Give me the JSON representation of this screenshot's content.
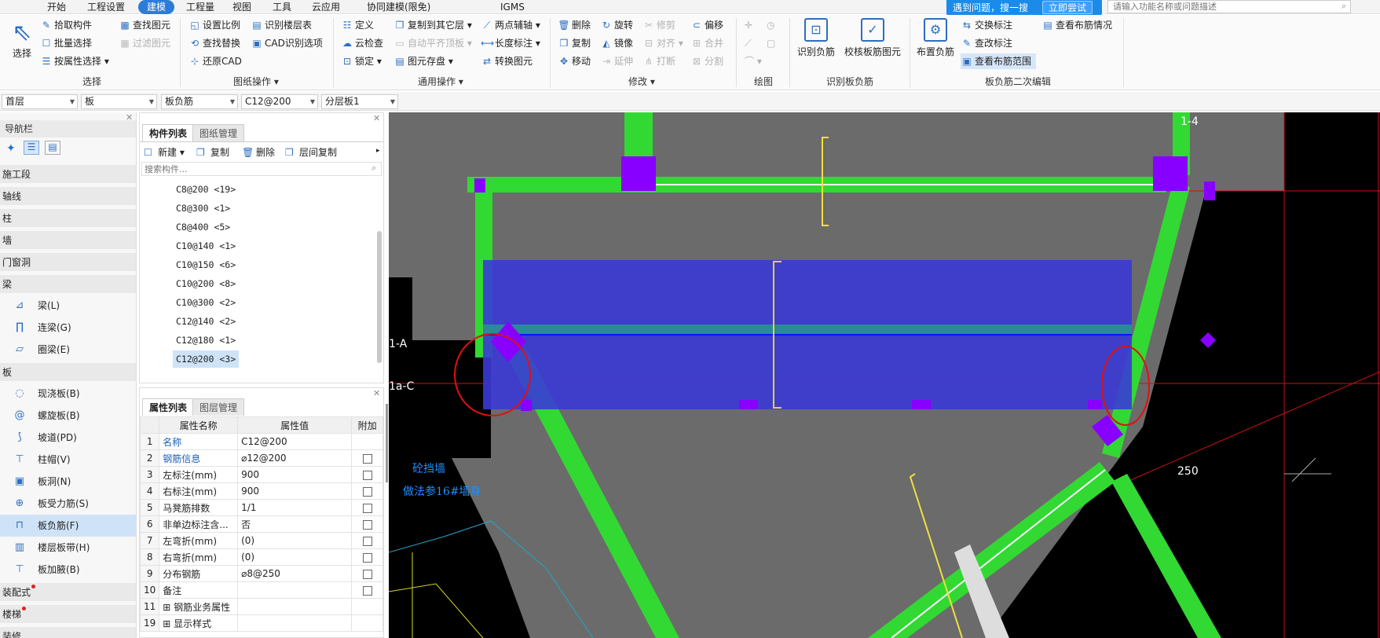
{
  "menu": [
    "开始",
    "工程设置",
    "建模",
    "工程量",
    "视图",
    "工具",
    "云应用",
    "协同建模(限免)",
    "IGMS"
  ],
  "active_menu": "建模",
  "promo": {
    "text": "遇到问题，搜一搜",
    "button": "立即尝试"
  },
  "search": {
    "placeholder": "请输入功能名称或问题描述"
  },
  "ribbon": {
    "select_big": "选择",
    "select_group": {
      "items": [
        "拾取构件",
        "批量选择",
        "按属性选择",
        "查找图元",
        "过滤图元"
      ],
      "label": "选择"
    },
    "drawing_group": {
      "items": [
        "设置比例",
        "查找替换",
        "还原CAD",
        "识别楼层表",
        "CAD识别选项"
      ],
      "label": "图纸操作"
    },
    "common_group": {
      "items": [
        "定义",
        "云检查",
        "锁定",
        "复制到其它层",
        "自动平齐顶板",
        "图元存盘",
        "两点辅轴",
        "长度标注",
        "转换图元"
      ],
      "label": "通用操作"
    },
    "modify_group": {
      "items": [
        "删除",
        "复制",
        "移动",
        "旋转",
        "镜像",
        "延伸",
        "修剪",
        "对齐",
        "打断",
        "偏移",
        "合并",
        "分割"
      ],
      "label": "修改"
    },
    "draw_group": {
      "label": "绘图"
    },
    "identify_group": {
      "items": [
        "识别负筋",
        "校核板筋图元"
      ],
      "label": "识别板负筋"
    },
    "edit2_group": {
      "items": [
        "布置负筋",
        "交换标注",
        "查改标注",
        "查看布筋范围",
        "查看布筋情况"
      ],
      "label": "板负筋二次编辑"
    }
  },
  "toolbar2": [
    "首层",
    "板",
    "板负筋",
    "C12@200",
    "分层板1"
  ],
  "nav": {
    "title": "导航栏",
    "categories": [
      "施工段",
      "轴线",
      "柱",
      "墙",
      "门窗洞",
      "梁",
      "板",
      "装配式",
      "楼梯",
      "装修"
    ],
    "beam_items": [
      "梁(L)",
      "连梁(G)",
      "圈梁(E)"
    ],
    "slab_items": [
      "现浇板(B)",
      "螺旋板(B)",
      "坡道(PD)",
      "柱帽(V)",
      "板洞(N)",
      "板受力筋(S)",
      "板负筋(F)",
      "楼层板带(H)",
      "板加腋(B)"
    ],
    "selected": "板负筋(F)"
  },
  "component_list": {
    "tabs": [
      "构件列表",
      "图纸管理"
    ],
    "tools": [
      "新建",
      "复制",
      "删除",
      "层间复制"
    ],
    "search_placeholder": "搜索构件...",
    "items": [
      "C8@200 <19>",
      "C8@300 <1>",
      "C8@400 <5>",
      "C10@140 <1>",
      "C10@150 <6>",
      "C10@200 <8>",
      "C10@300 <2>",
      "C12@140 <2>",
      "C12@180 <1>",
      "C12@200 <3>"
    ],
    "selected": "C12@200 <3>"
  },
  "properties": {
    "tabs": [
      "属性列表",
      "图层管理"
    ],
    "headers": [
      "属性名称",
      "属性值",
      "附加"
    ],
    "rows": [
      {
        "n": "1",
        "name": "名称",
        "value": "C12@200",
        "cb": false,
        "link": true
      },
      {
        "n": "2",
        "name": "钢筋信息",
        "value": "⌀12@200",
        "cb": true,
        "link": true
      },
      {
        "n": "3",
        "name": "左标注(mm)",
        "value": "900",
        "cb": true,
        "link": false
      },
      {
        "n": "4",
        "name": "右标注(mm)",
        "value": "900",
        "cb": true,
        "link": false
      },
      {
        "n": "5",
        "name": "马凳筋排数",
        "value": "1/1",
        "cb": true,
        "link": false
      },
      {
        "n": "6",
        "name": "非单边标注含...",
        "value": "否",
        "cb": true,
        "link": false
      },
      {
        "n": "7",
        "name": "左弯折(mm)",
        "value": "(0)",
        "cb": true,
        "link": false
      },
      {
        "n": "8",
        "name": "右弯折(mm)",
        "value": "(0)",
        "cb": true,
        "link": false
      },
      {
        "n": "9",
        "name": "分布钢筋",
        "value": "⌀8@250",
        "cb": true,
        "link": false
      },
      {
        "n": "10",
        "name": "备注",
        "value": "",
        "cb": true,
        "link": false
      },
      {
        "n": "11",
        "name": "钢筋业务属性",
        "value": "",
        "cb": false,
        "link": false,
        "expand": true
      },
      {
        "n": "19",
        "name": "显示样式",
        "value": "",
        "cb": false,
        "link": false,
        "expand": true
      }
    ]
  },
  "canvas": {
    "axis_labels": [
      "1-4",
      "1-A",
      "1a-C"
    ],
    "dimension": "250",
    "cad_text_1": "砼挡墙",
    "cad_text_2": "做法参16#墙身"
  },
  "colors": {
    "accent": "#2b7cd9",
    "beam": "#32d932",
    "slab": "#3a3ad6",
    "column": "#8800ff",
    "annotation": "#e01010",
    "canvas_bg": "#000000",
    "slab_gray": "#6b6b6b"
  }
}
